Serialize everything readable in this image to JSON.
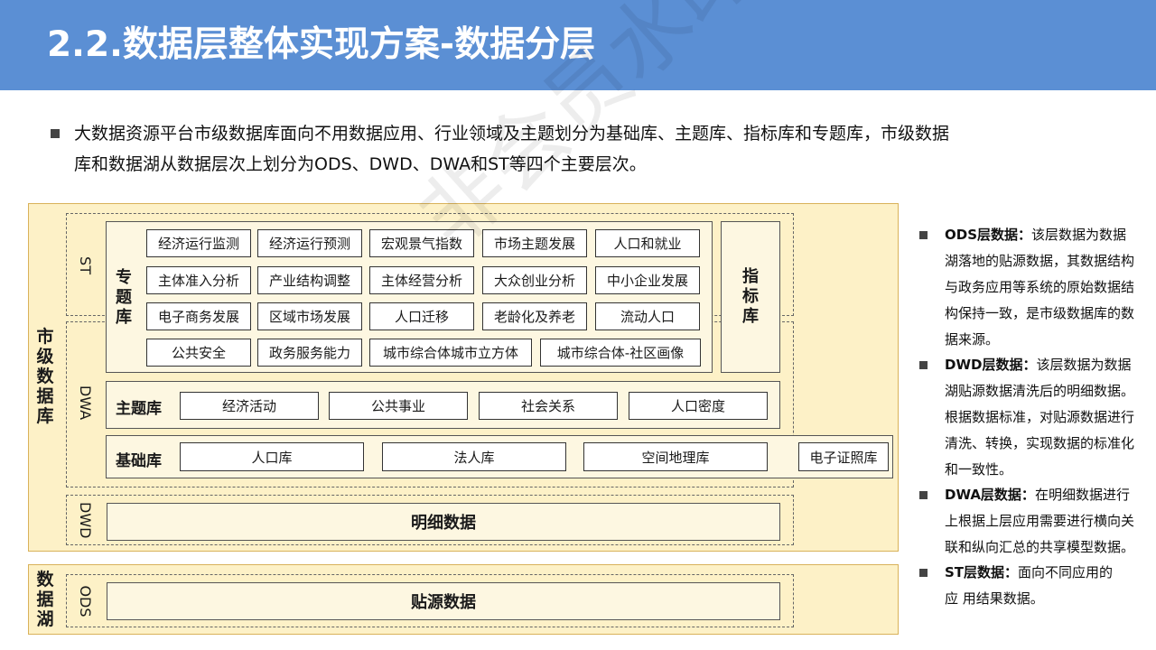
{
  "header": {
    "title": "2.2.数据层整体实现方案-数据分层"
  },
  "intro": {
    "line1": "大数据资源平台市级数据库面向不用数据应用、行业领域及主题划分为基础库、主题库、指标库和专题库，市级数据",
    "line2": "库和数据湖从数据层次上划分为ODS、DWD、DWA和ST等四个主要层次。"
  },
  "watermark": "非会员水印",
  "diagram": {
    "city_db_label": "市级数据库",
    "lake_label": "数据湖",
    "layers": {
      "st": "ST",
      "dwa": "DWA",
      "dwd": "DWD",
      "ods": "ODS"
    },
    "special": {
      "label": "专题库",
      "rows": [
        [
          "经济运行监测",
          "经济运行预测",
          "宏观景气指数",
          "市场主题发展",
          "人口和就业"
        ],
        [
          "主体准入分析",
          "产业结构调整",
          "主体经营分析",
          "大众创业分析",
          "中小企业发展"
        ],
        [
          "电子商务发展",
          "区域市场发展",
          "人口迁移",
          "老龄化及养老",
          "流动人口"
        ],
        [
          "公共安全",
          "政务服务能力",
          "城市综合体城市立方体",
          "城市综合体-社区画像"
        ]
      ]
    },
    "indicator": {
      "label": "指标库"
    },
    "theme": {
      "label": "主题库",
      "items": [
        "经济活动",
        "公共事业",
        "社会关系",
        "人口密度"
      ]
    },
    "base": {
      "label": "基础库",
      "items": [
        "人口库",
        "法人库",
        "空间地理库",
        "电子证照库"
      ]
    },
    "detail": "明细数据",
    "source": "贴源数据"
  },
  "notes": [
    {
      "head": "ODS层数据：",
      "lines": [
        "该层数据为数据",
        "湖落地的贴源数据，其数据结构",
        "与政务应用等系统的原始数据结",
        "构保持一致，是市级数据库的数",
        "据来源。"
      ]
    },
    {
      "head": "DWD层数据：",
      "lines": [
        "该层数据为数据",
        "湖贴源数据清洗后的明细数据。",
        "根据数据标准，对贴源数据进行",
        "清洗、转换，实现数据的标准化",
        "和一致性。"
      ]
    },
    {
      "head": "DWA层数据：",
      "lines": [
        "在明细数据进行",
        "上根据上层应用需要进行横向关",
        "联和纵向汇总的共享模型数据。"
      ]
    },
    {
      "head": "ST层数据：",
      "lines": [
        "面向不同应用的",
        "应 用结果数据。"
      ]
    }
  ]
}
